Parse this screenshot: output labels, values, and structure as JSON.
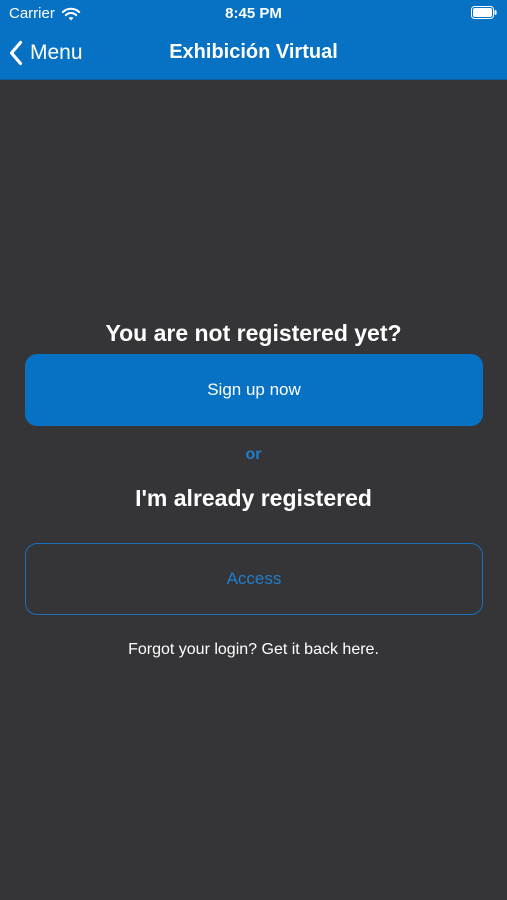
{
  "status_bar": {
    "carrier": "Carrier",
    "time": "8:45 PM"
  },
  "nav": {
    "back_label": "Menu",
    "title": "Exhibición Virtual"
  },
  "main": {
    "signup_heading": "You are not registered yet?",
    "signup_button": "Sign up now",
    "or_label": "or",
    "access_heading": "I'm already registered",
    "access_button": "Access",
    "forgot_link": "Forgot your login? Get it back here."
  },
  "colors": {
    "accent": "#0772c3",
    "background": "#353538",
    "text": "#ffffff"
  },
  "icons": {
    "wifi": "wifi-icon",
    "battery": "battery-icon",
    "back": "chevron-left-icon"
  }
}
